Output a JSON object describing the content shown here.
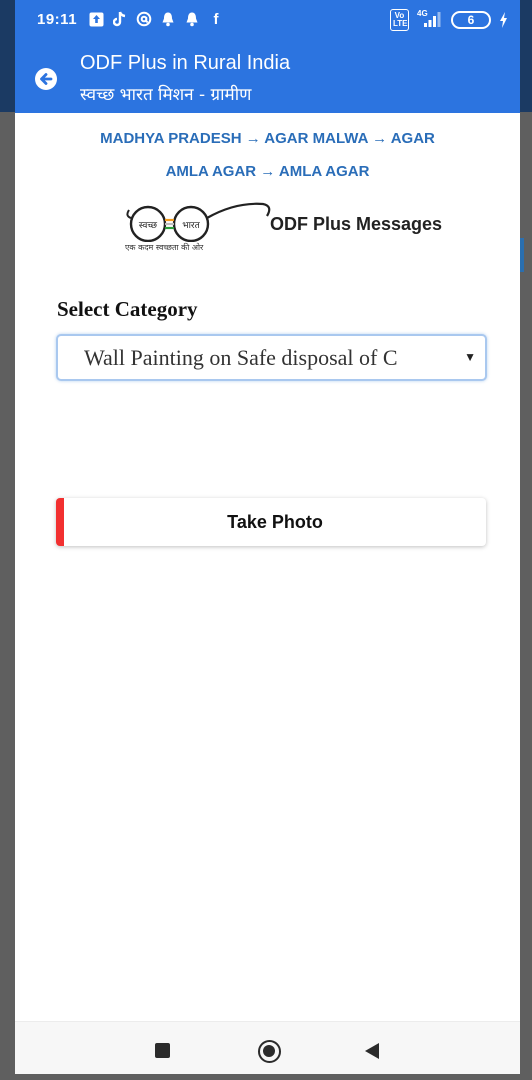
{
  "status_bar": {
    "time": "19:11",
    "left_icons": [
      "upload-notification-icon",
      "tiktok-icon",
      "at-sign-icon",
      "bell-icon",
      "bell-icon",
      "facebook-icon"
    ],
    "facebook_glyph": "f",
    "volte": "Vo LTE",
    "network": "4G",
    "battery_level": "6"
  },
  "app_bar": {
    "title": "ODF Plus in Rural India",
    "subtitle": "स्वच्छ भारत मिशन - ग्रामीण",
    "back_icon": "arrow-left-circle-icon",
    "color": "#2c74e0"
  },
  "breadcrumb": {
    "line1": "MADHYA PRADESH → AGAR MALWA → AGAR",
    "line2": "AMLA AGAR → AMLA AGAR",
    "color": "#2a6db8"
  },
  "logo": {
    "left_word": "स्वच्छ",
    "right_word": "भारत",
    "tagline": "एक कदम स्वच्छता की ओर"
  },
  "messages_title": "ODF Plus Messages",
  "category": {
    "label": "Select Category",
    "selected": "Wall Painting on Safe disposal of C"
  },
  "take_photo": {
    "label": "Take Photo",
    "accent": "#f23030"
  },
  "nav_bar": {
    "icons": [
      "recent-apps-icon",
      "home-icon",
      "back-triangle-icon"
    ]
  }
}
